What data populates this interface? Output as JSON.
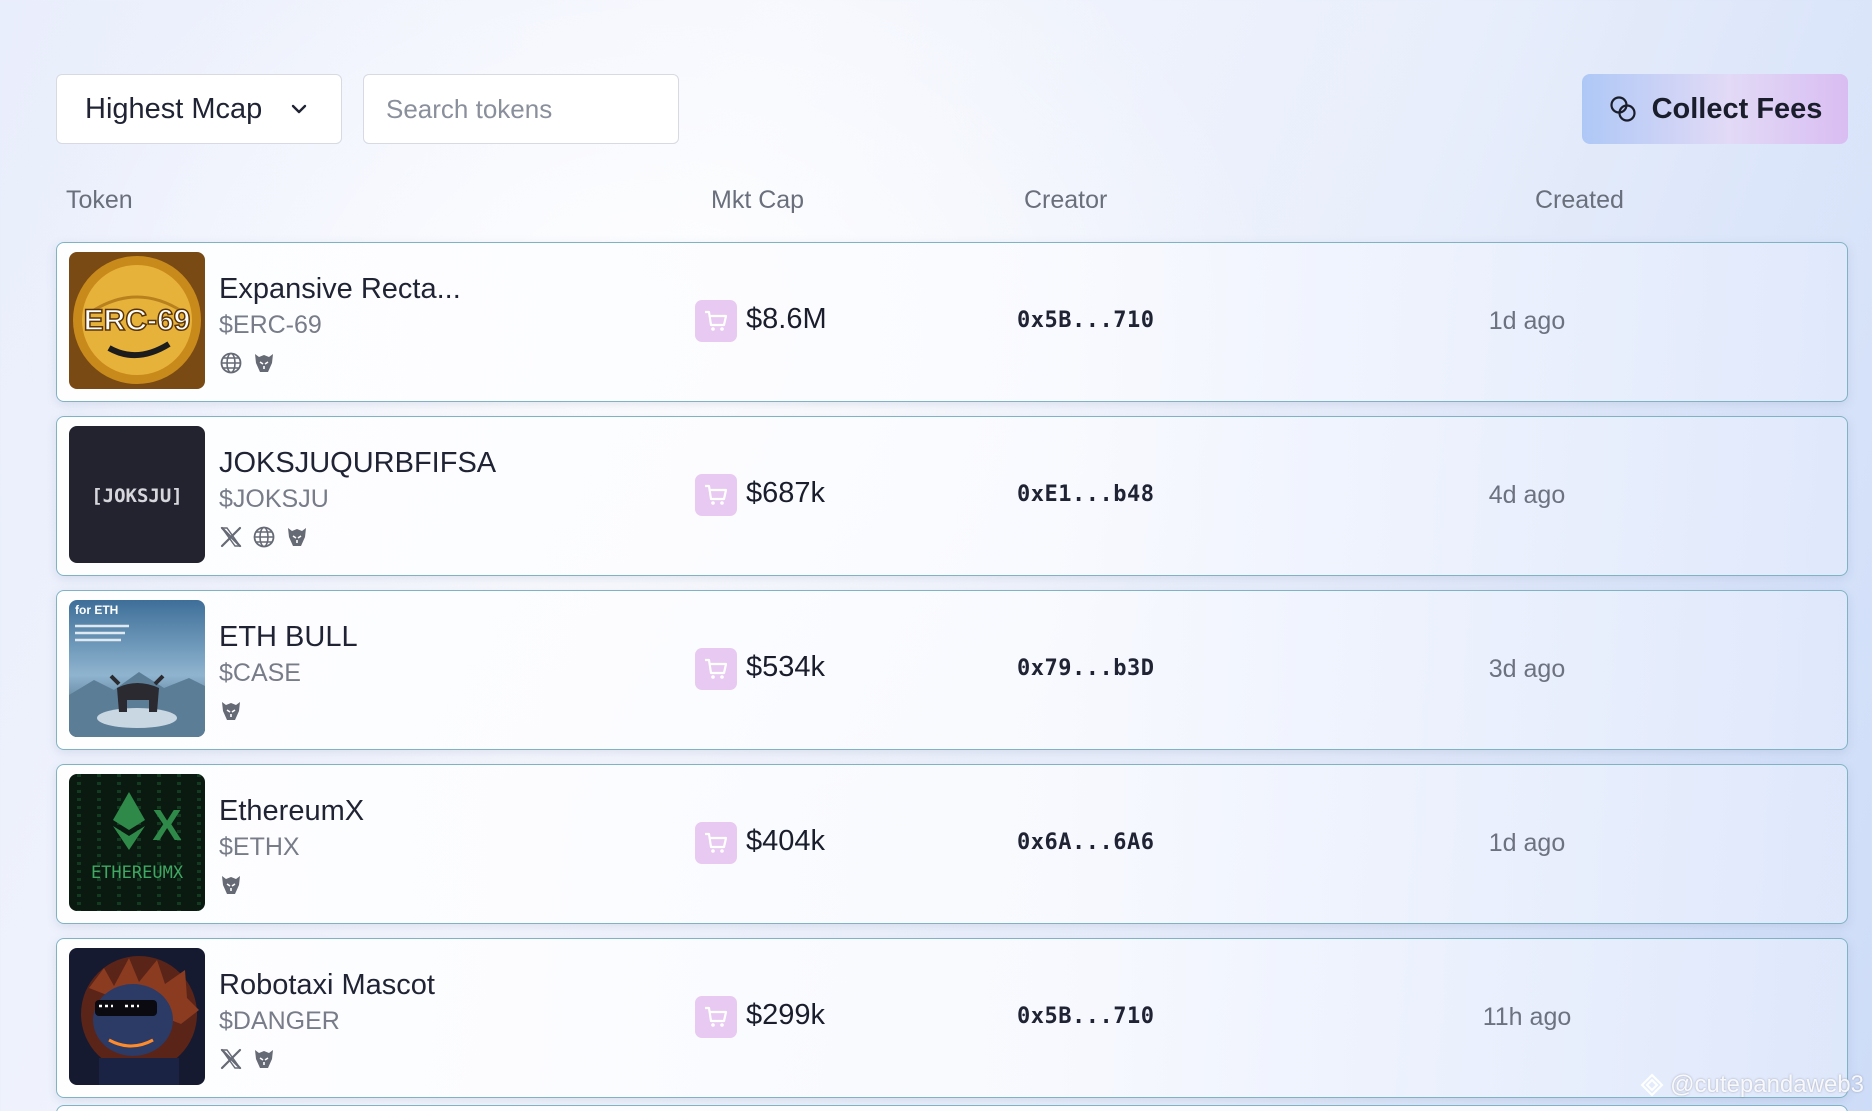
{
  "toolbar": {
    "sort_label": "Highest Mcap",
    "search_placeholder": "Search tokens",
    "collect_fees_label": "Collect Fees"
  },
  "columns": [
    "Token",
    "Mkt Cap",
    "Creator",
    "Created"
  ],
  "tokens": [
    {
      "name": "Expansive Recta...",
      "symbol": "$ERC-69",
      "market_cap": "$8.6M",
      "creator": "0x5B...710",
      "created": "1d ago",
      "socials": [
        "globe-icon",
        "farcaster-icon"
      ],
      "image_text": "ERC-69"
    },
    {
      "name": "JOKSJUQURBFIFSA",
      "symbol": "$JOKSJU",
      "market_cap": "$687k",
      "creator": "0xE1...b48",
      "created": "4d ago",
      "socials": [
        "x-icon",
        "globe-icon",
        "farcaster-icon"
      ],
      "image_text": "[JOKSJU]"
    },
    {
      "name": "ETH BULL",
      "symbol": "$CASE",
      "market_cap": "$534k",
      "creator": "0x79...b3D",
      "created": "3d ago",
      "socials": [
        "farcaster-icon"
      ],
      "image_text": "for ETH"
    },
    {
      "name": "EthereumX",
      "symbol": "$ETHX",
      "market_cap": "$404k",
      "creator": "0x6A...6A6",
      "created": "1d ago",
      "socials": [
        "farcaster-icon"
      ],
      "image_text": "ETHEREUMX"
    },
    {
      "name": "Robotaxi Mascot",
      "symbol": "$DANGER",
      "market_cap": "$299k",
      "creator": "0x5B...710",
      "created": "11h ago",
      "socials": [
        "x-icon",
        "farcaster-icon"
      ],
      "image_text": ""
    }
  ],
  "watermark": "@cutepandaweb3",
  "colors": {
    "row_border": "#7fb3c4",
    "cart_bg": "#e8c9f1",
    "button_gradient_start": "#aec8f6",
    "button_gradient_end": "#d9bdf2"
  }
}
